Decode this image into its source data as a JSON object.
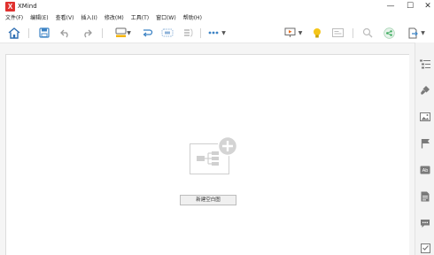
{
  "window": {
    "title": "XMind",
    "logo_text": "X",
    "controls": {
      "minimize": "—",
      "maximize": "☐",
      "close": "✕"
    }
  },
  "menu": [
    {
      "label": "文件(F)"
    },
    {
      "label": "编辑(E)"
    },
    {
      "label": "查看(V)"
    },
    {
      "label": "插入(I)"
    },
    {
      "label": "修改(M)"
    },
    {
      "label": "工具(T)"
    },
    {
      "label": "窗口(W)"
    },
    {
      "label": "帮助(H)"
    }
  ],
  "toolbar": {
    "icons": [
      "home-icon",
      "save-icon",
      "undo-icon",
      "redo-icon",
      "topic-style-icon",
      "relationship-icon",
      "boundary-icon",
      "summary-icon",
      "more-icon",
      "presentation-icon",
      "idea-icon",
      "outline-view-icon",
      "search-icon",
      "share-icon",
      "export-icon"
    ]
  },
  "right_panel": {
    "icons": [
      "outliner-icon",
      "format-brush-icon",
      "image-icon",
      "marker-flag-icon",
      "label-icon",
      "notes-icon",
      "comment-icon",
      "task-icon"
    ],
    "label_icon_text": "Ab"
  },
  "empty_state": {
    "new_blank_map_label": "新建空白图"
  },
  "colors": {
    "accent_blue": "#3b82c4",
    "logo_red": "#e0312f",
    "idea_yellow": "#f5c518",
    "share_green": "#3aaa5c"
  }
}
